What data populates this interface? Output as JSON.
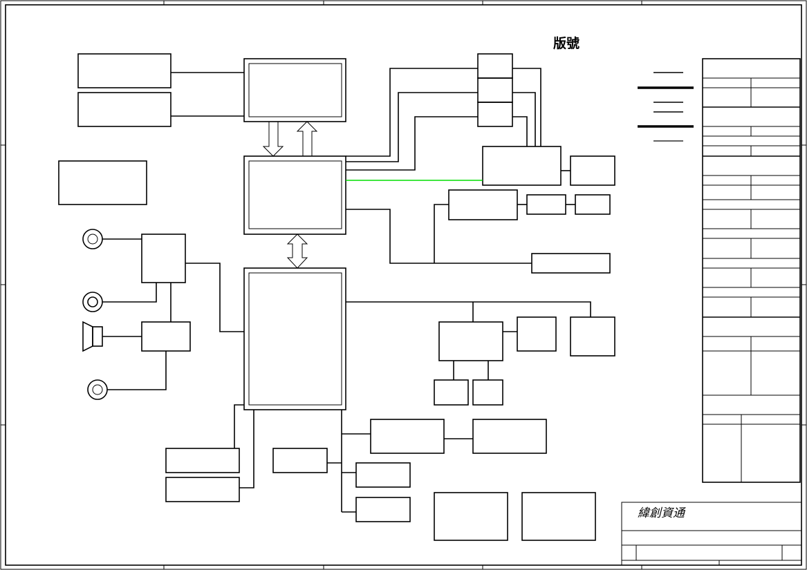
{
  "sheet": {
    "version_label": "版號",
    "company_name": "緯創資通"
  }
}
